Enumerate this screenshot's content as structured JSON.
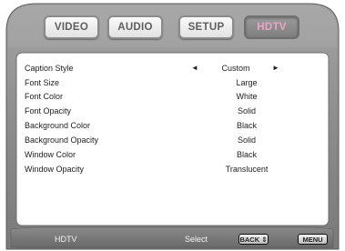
{
  "tabs": [
    {
      "label": "VIDEO"
    },
    {
      "label": "AUDIO"
    },
    {
      "label": "SETUP"
    },
    {
      "label": "HDTV"
    }
  ],
  "active_tab": "HDTV",
  "settings": [
    {
      "label": "Caption Style",
      "value": "Custom"
    },
    {
      "label": "Font Size",
      "value": "Large"
    },
    {
      "label": "Font Color",
      "value": "White"
    },
    {
      "label": "Font Opacity",
      "value": "Solid"
    },
    {
      "label": "Background Color",
      "value": "Black"
    },
    {
      "label": "Background Opacity",
      "value": "Solid"
    },
    {
      "label": "Window Color",
      "value": "Black"
    },
    {
      "label": "Window Opacity",
      "value": "Translucent"
    }
  ],
  "selector": {
    "left_arrow": "◄",
    "right_arrow": "►"
  },
  "status_bar": {
    "title": "HDTV",
    "hint": "Select",
    "back_button": "BACK ⇕",
    "menu_button": "MENU"
  },
  "colors": {
    "frame": "#8a8a8a",
    "active_tab_text": "#e9a7c4",
    "panel": "#ffffff"
  }
}
